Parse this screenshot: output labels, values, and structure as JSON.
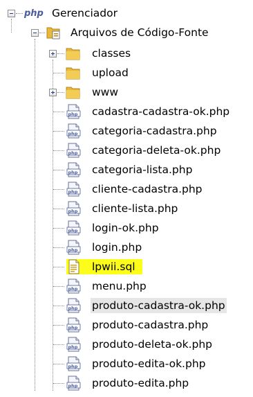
{
  "tree": {
    "root": {
      "label": "Gerenciador",
      "badge": "php",
      "expanded": true
    },
    "source_folder": {
      "label": "Arquivos de Código-Fonte",
      "expanded": true
    },
    "folders": [
      {
        "label": "classes",
        "expandable": true
      },
      {
        "label": "upload",
        "expandable": false
      },
      {
        "label": "www",
        "expandable": true
      }
    ],
    "files": [
      {
        "label": "cadastra-cadastra-ok.php",
        "type": "php"
      },
      {
        "label": "categoria-cadastra.php",
        "type": "php"
      },
      {
        "label": "categoria-deleta-ok.php",
        "type": "php"
      },
      {
        "label": "categoria-lista.php",
        "type": "php"
      },
      {
        "label": "cliente-cadastra.php",
        "type": "php"
      },
      {
        "label": "cliente-lista.php",
        "type": "php"
      },
      {
        "label": "login-ok.php",
        "type": "php"
      },
      {
        "label": "login.php",
        "type": "php"
      },
      {
        "label": "lpwii.sql",
        "type": "sql",
        "highlighted": true
      },
      {
        "label": "menu.php",
        "type": "php"
      },
      {
        "label": "produto-cadastra-ok.php",
        "type": "php",
        "selected": true
      },
      {
        "label": "produto-cadastra.php",
        "type": "php"
      },
      {
        "label": "produto-deleta-ok.php",
        "type": "php"
      },
      {
        "label": "produto-edita-ok.php",
        "type": "php"
      },
      {
        "label": "produto-edita.php",
        "type": "php"
      }
    ],
    "colors": {
      "highlight": "#fdfd1c",
      "selected": "#e6e6e6",
      "folder": "#e8b83a",
      "php_icon": "#4a5d9a"
    }
  }
}
